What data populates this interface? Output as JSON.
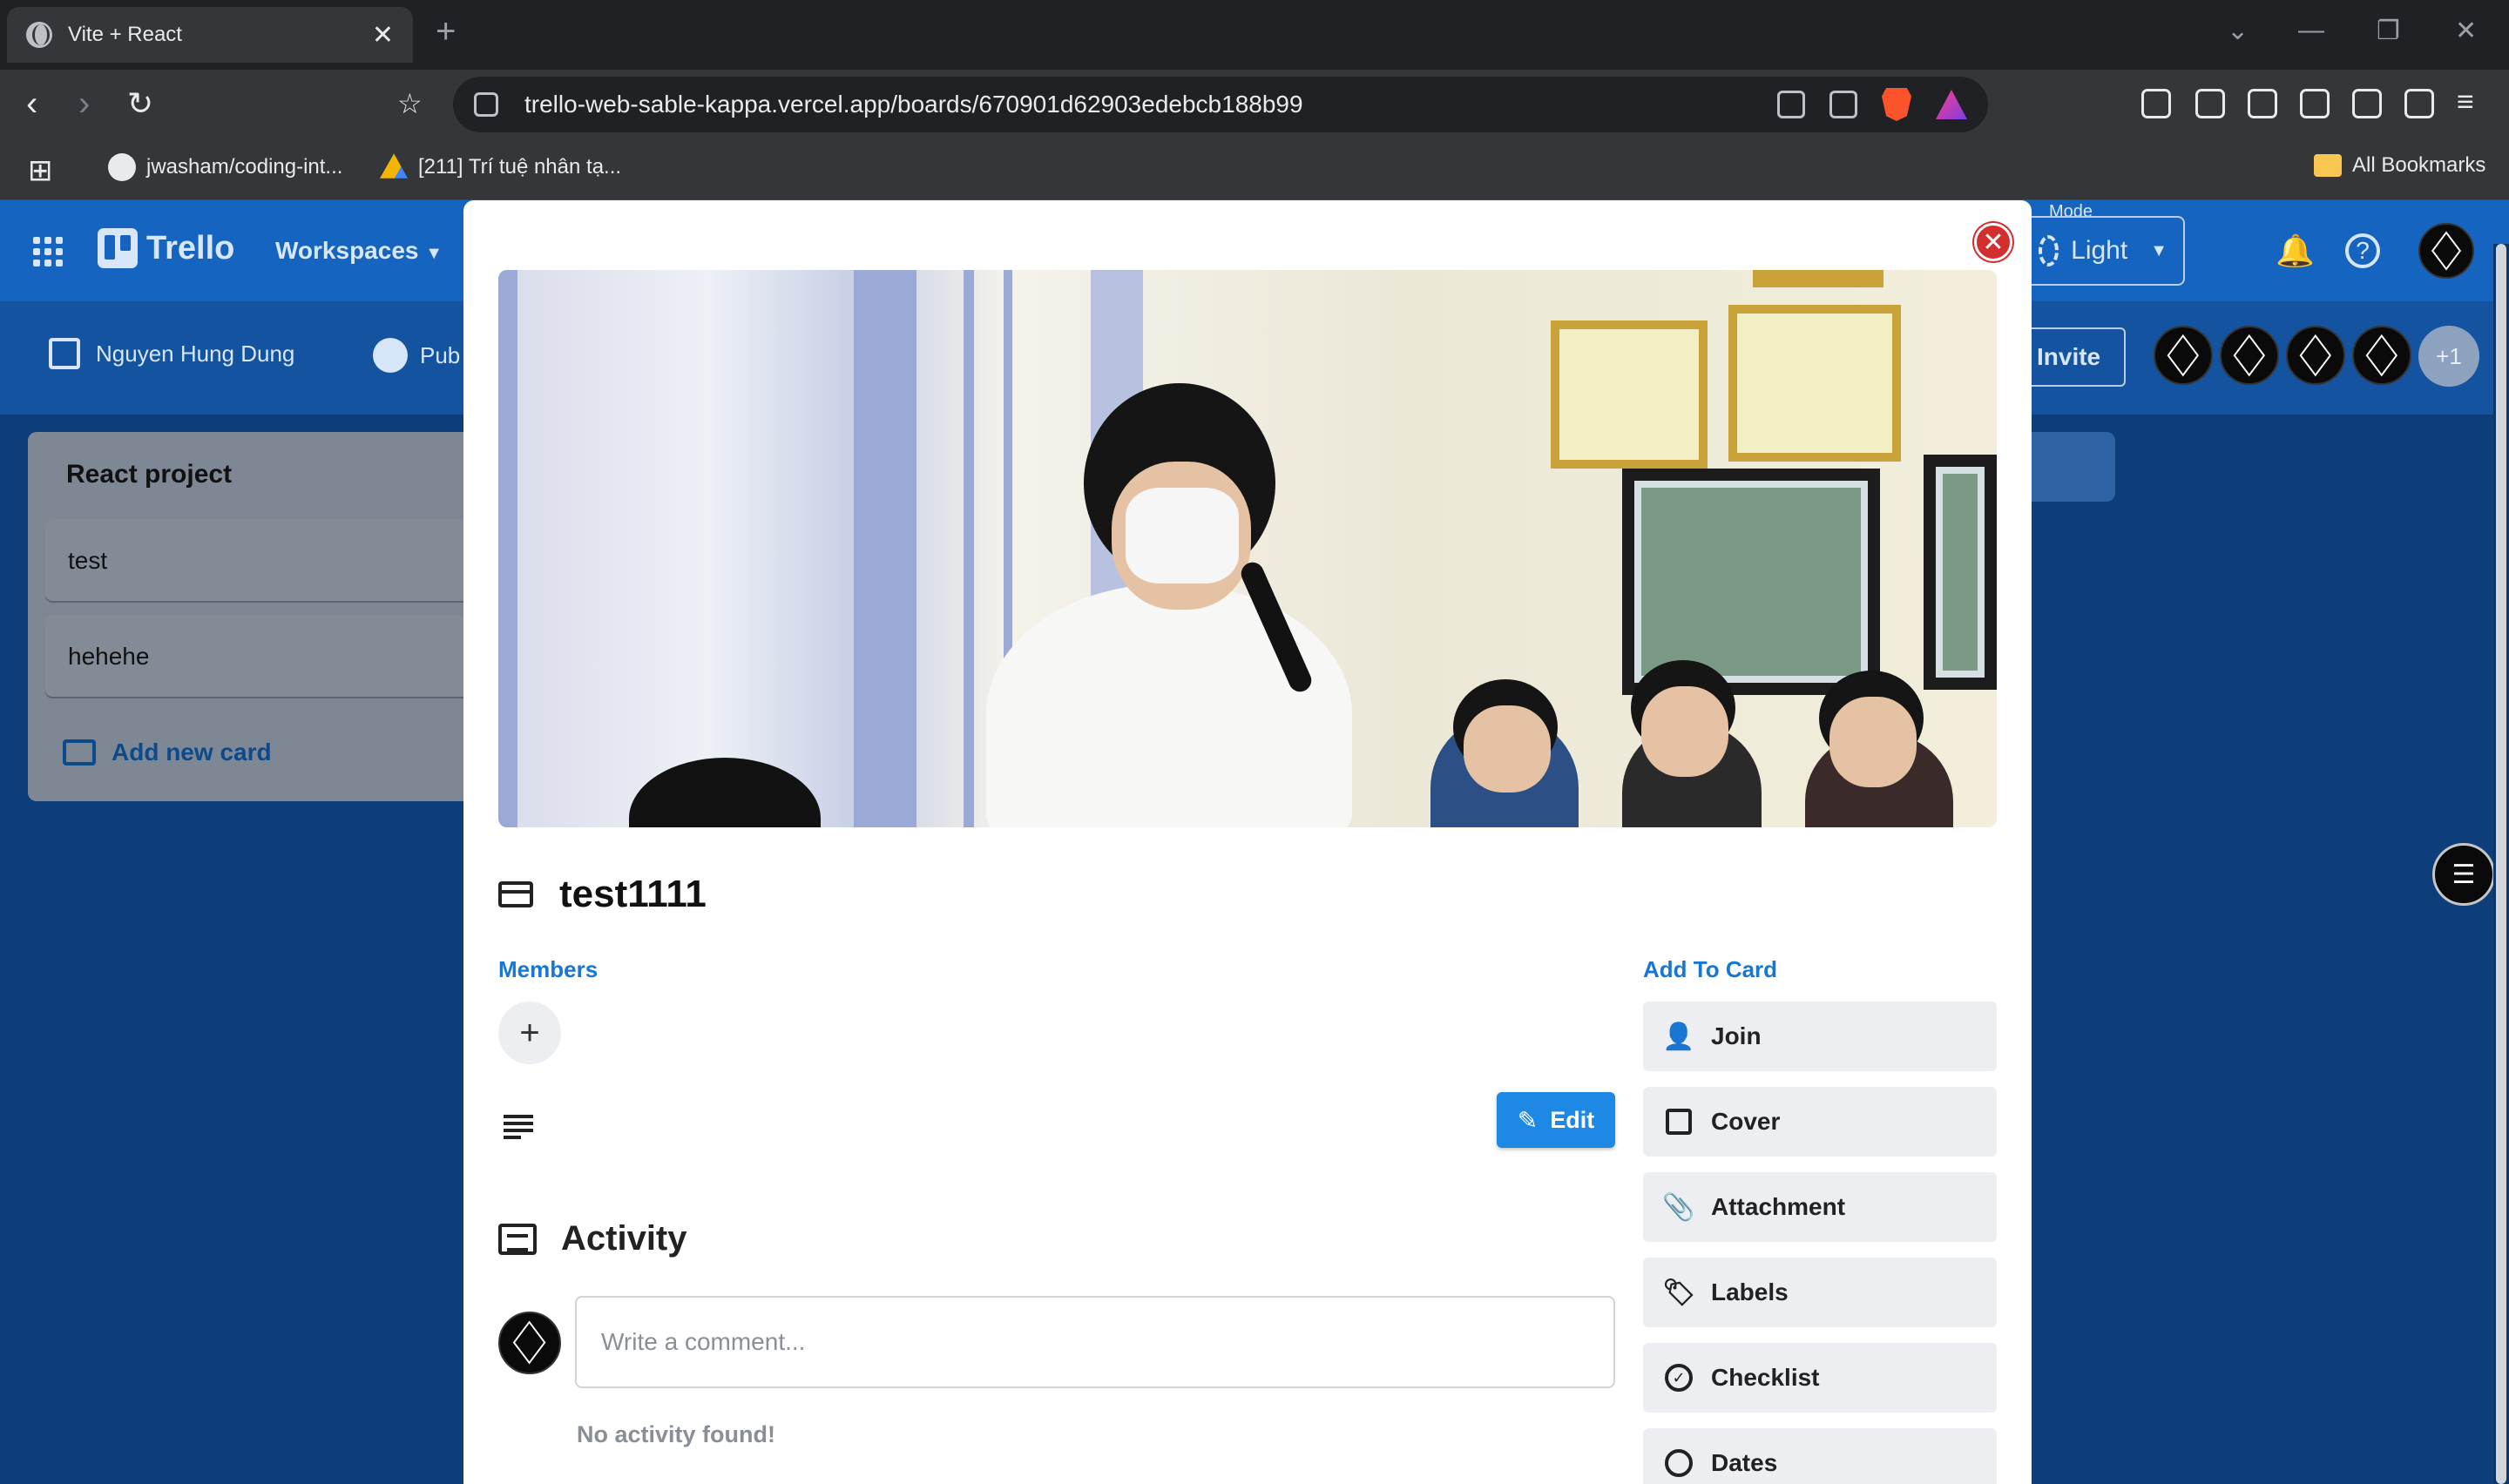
{
  "browser": {
    "tab_title": "Vite + React",
    "tab_close": "✕",
    "new_tab": "+",
    "url": "trello-web-sable-kappa.vercel.app/boards/670901d62903edebcb188b99",
    "bookmarks": [
      {
        "label": "jwasham/coding-int..."
      },
      {
        "label": "[211] Trí tuệ nhân tạ..."
      }
    ],
    "all_bookmarks": "All Bookmarks"
  },
  "header": {
    "logo_text": "Trello",
    "workspaces": "Workspaces",
    "mode_label": "Mode",
    "mode_value": "Light"
  },
  "board": {
    "owner": "Nguyen Hung Dung",
    "visibility": "Pub",
    "invite": "Invite",
    "extra_members": "+1",
    "column": {
      "title": "React project",
      "cards": [
        "test",
        "hehehe"
      ],
      "add_card": "Add new card"
    }
  },
  "modal": {
    "card_title": "test1111",
    "members_label": "Members",
    "add_to_card_label": "Add To Card",
    "edit": "Edit",
    "activity_title": "Activity",
    "comment_placeholder": "Write a comment...",
    "no_activity": "No activity found!",
    "actions": [
      "Join",
      "Cover",
      "Attachment",
      "Labels",
      "Checklist",
      "Dates"
    ],
    "close_color": "#d32f2f",
    "accent_color": "#1976d2"
  }
}
